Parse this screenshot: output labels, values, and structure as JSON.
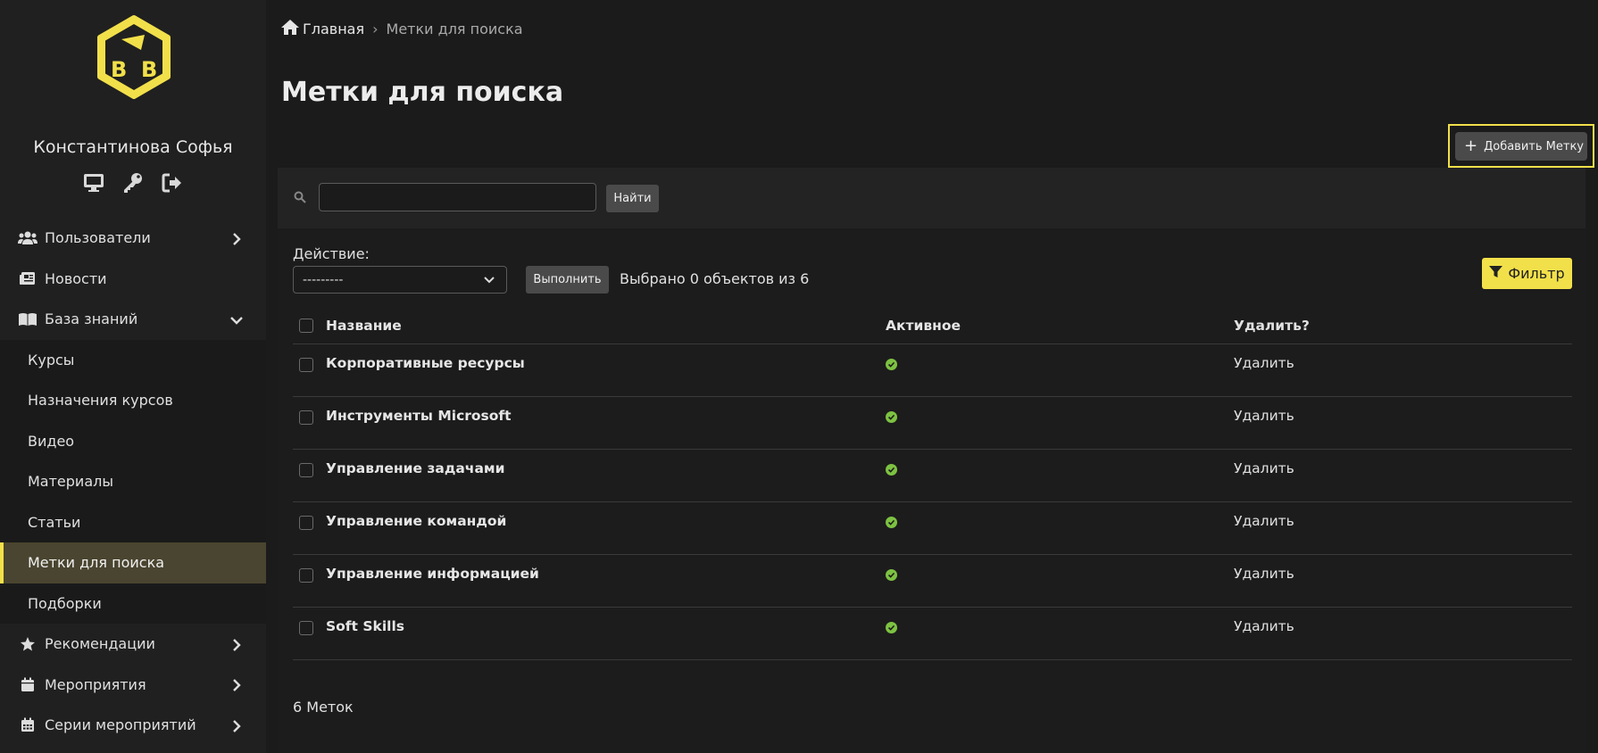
{
  "user": {
    "name": "Константинова Софья"
  },
  "user_icons": [
    "monitor-icon",
    "key-icon",
    "sign-out-icon"
  ],
  "nav": {
    "users": "Пользователи",
    "news": "Новости",
    "knowledge": "База знаний",
    "sub": [
      "Курсы",
      "Назначения курсов",
      "Видео",
      "Материалы",
      "Статьи",
      "Метки для поиска",
      "Подборки"
    ],
    "recommendations": "Рекомендации",
    "events": "Мероприятия",
    "event_series": "Серии мероприятий"
  },
  "breadcrumb": {
    "home": "Главная",
    "current": "Метки для поиска"
  },
  "page": {
    "title": "Метки для поиска"
  },
  "add_button": {
    "label": "Добавить Метку"
  },
  "search": {
    "value": "",
    "button": "Найти"
  },
  "actions": {
    "label": "Действие:",
    "selected": "---------",
    "run": "Выполнить",
    "selected_info": "Выбрано 0 объектов из 6"
  },
  "filter": {
    "label": "Фильтр"
  },
  "table": {
    "headers": {
      "name": "Название",
      "active": "Активное",
      "delete": "Удалить?"
    },
    "rows": [
      {
        "name": "Корпоративные ресурсы",
        "active": true,
        "delete": "Удалить"
      },
      {
        "name": "Инструменты Microsoft",
        "active": true,
        "delete": "Удалить"
      },
      {
        "name": "Управление задачами",
        "active": true,
        "delete": "Удалить"
      },
      {
        "name": "Управление командой",
        "active": true,
        "delete": "Удалить"
      },
      {
        "name": "Управление информацией",
        "active": true,
        "delete": "Удалить"
      },
      {
        "name": "Soft Skills",
        "active": true,
        "delete": "Удалить"
      }
    ]
  },
  "footer": {
    "count": "6 Меток"
  },
  "colors": {
    "accent": "#f2e04a",
    "active_bg": "#4a4530",
    "check": "#7dc242",
    "arrow": "#e0344f"
  }
}
